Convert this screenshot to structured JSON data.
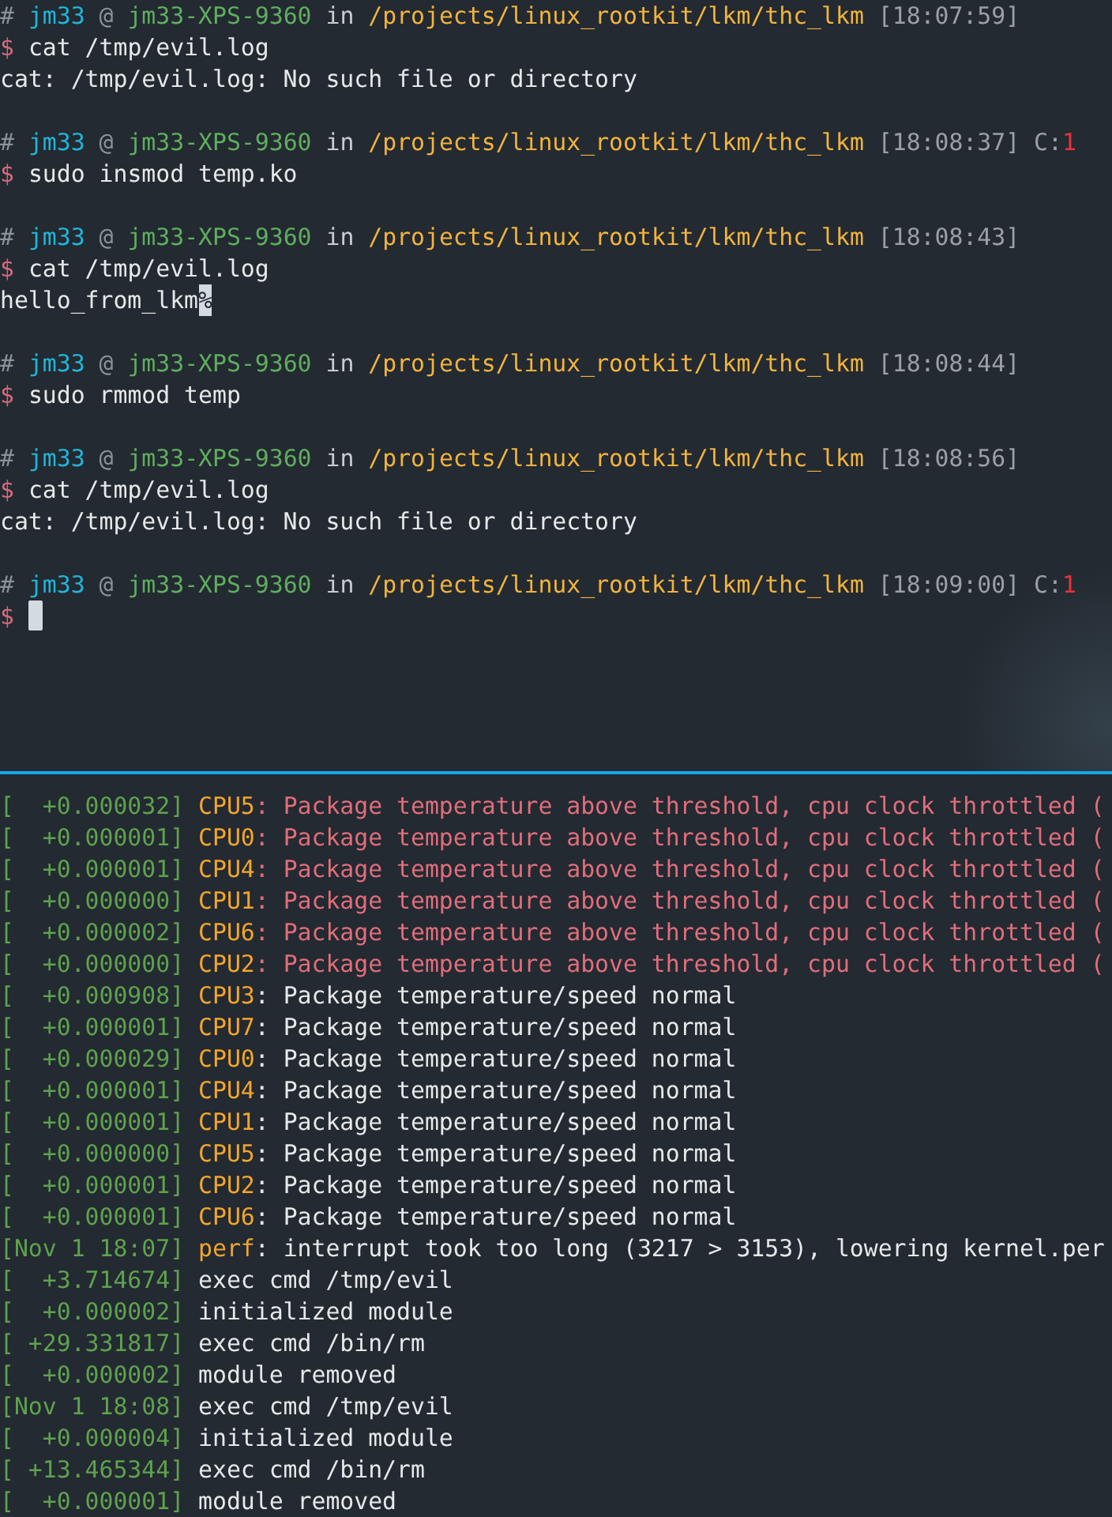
{
  "shell": {
    "prompts": [
      {
        "marker": "#",
        "user": "jm33",
        "at": "@",
        "host": "jm33-XPS-9360",
        "in": "in",
        "path": "/projects/linux_rootkit/lkm/thc_lkm",
        "time": "[18:07:59]",
        "symbol": "$",
        "command": "cat /tmp/evil.log",
        "output": [
          {
            "kind": "text",
            "text": "cat: /tmp/evil.log: No such file or directory"
          }
        ]
      },
      {
        "marker": "#",
        "user": "jm33",
        "at": "@",
        "host": "jm33-XPS-9360",
        "in": "in",
        "path": "/projects/linux_rootkit/lkm/thc_lkm",
        "time": "[18:08:37]",
        "exit_label": "C:",
        "exit_code": "1",
        "symbol": "$",
        "command": "sudo insmod temp.ko"
      },
      {
        "marker": "#",
        "user": "jm33",
        "at": "@",
        "host": "jm33-XPS-9360",
        "in": "in",
        "path": "/projects/linux_rootkit/lkm/thc_lkm",
        "time": "[18:08:43]",
        "symbol": "$",
        "command": "cat /tmp/evil.log",
        "output": [
          {
            "kind": "partial",
            "text": "hello_from_lkm",
            "mark": "%"
          }
        ]
      },
      {
        "marker": "#",
        "user": "jm33",
        "at": "@",
        "host": "jm33-XPS-9360",
        "in": "in",
        "path": "/projects/linux_rootkit/lkm/thc_lkm",
        "time": "[18:08:44]",
        "symbol": "$",
        "command": "sudo rmmod temp"
      },
      {
        "marker": "#",
        "user": "jm33",
        "at": "@",
        "host": "jm33-XPS-9360",
        "in": "in",
        "path": "/projects/linux_rootkit/lkm/thc_lkm",
        "time": "[18:08:56]",
        "symbol": "$",
        "command": "cat /tmp/evil.log",
        "output": [
          {
            "kind": "text",
            "text": "cat: /tmp/evil.log: No such file or directory"
          }
        ]
      },
      {
        "marker": "#",
        "user": "jm33",
        "at": "@",
        "host": "jm33-XPS-9360",
        "in": "in",
        "path": "/projects/linux_rootkit/lkm/thc_lkm",
        "time": "[18:09:00]",
        "exit_label": "C:",
        "exit_code": "1",
        "symbol": "$",
        "cursor": true
      }
    ]
  },
  "kernel_log": [
    {
      "timestamp": "[  +0.000032]",
      "source": "CPU5",
      "alert": true,
      "message": ": Package temperature above threshold, cpu clock throttled ("
    },
    {
      "timestamp": "[  +0.000001]",
      "source": "CPU0",
      "alert": true,
      "message": ": Package temperature above threshold, cpu clock throttled ("
    },
    {
      "timestamp": "[  +0.000001]",
      "source": "CPU4",
      "alert": true,
      "message": ": Package temperature above threshold, cpu clock throttled ("
    },
    {
      "timestamp": "[  +0.000000]",
      "source": "CPU1",
      "alert": true,
      "message": ": Package temperature above threshold, cpu clock throttled ("
    },
    {
      "timestamp": "[  +0.000002]",
      "source": "CPU6",
      "alert": true,
      "message": ": Package temperature above threshold, cpu clock throttled ("
    },
    {
      "timestamp": "[  +0.000000]",
      "source": "CPU2",
      "alert": true,
      "message": ": Package temperature above threshold, cpu clock throttled ("
    },
    {
      "timestamp": "[  +0.000908]",
      "source": "CPU3",
      "alert": false,
      "message": ": Package temperature/speed normal"
    },
    {
      "timestamp": "[  +0.000001]",
      "source": "CPU7",
      "alert": false,
      "message": ": Package temperature/speed normal"
    },
    {
      "timestamp": "[  +0.000029]",
      "source": "CPU0",
      "alert": false,
      "message": ": Package temperature/speed normal"
    },
    {
      "timestamp": "[  +0.000001]",
      "source": "CPU4",
      "alert": false,
      "message": ": Package temperature/speed normal"
    },
    {
      "timestamp": "[  +0.000001]",
      "source": "CPU1",
      "alert": false,
      "message": ": Package temperature/speed normal"
    },
    {
      "timestamp": "[  +0.000000]",
      "source": "CPU5",
      "alert": false,
      "message": ": Package temperature/speed normal"
    },
    {
      "timestamp": "[  +0.000001]",
      "source": "CPU2",
      "alert": false,
      "message": ": Package temperature/speed normal"
    },
    {
      "timestamp": "[  +0.000001]",
      "source": "CPU6",
      "alert": false,
      "message": ": Package temperature/speed normal"
    },
    {
      "timestamp": "[Nov 1 18:07]",
      "source": "perf",
      "alert": false,
      "message": ": interrupt took too long (3217 > 3153), lowering kernel.per"
    },
    {
      "timestamp": "[  +3.714674]",
      "alert": false,
      "message": "exec cmd /tmp/evil"
    },
    {
      "timestamp": "[  +0.000002]",
      "alert": false,
      "message": "initialized module"
    },
    {
      "timestamp": "[ +29.331817]",
      "alert": false,
      "message": "exec cmd /bin/rm"
    },
    {
      "timestamp": "[  +0.000002]",
      "alert": false,
      "message": "module removed"
    },
    {
      "timestamp": "[Nov 1 18:08]",
      "alert": false,
      "message": "exec cmd /tmp/evil"
    },
    {
      "timestamp": "[  +0.000004]",
      "alert": false,
      "message": "initialized module"
    },
    {
      "timestamp": "[ +13.465344]",
      "alert": false,
      "message": "exec cmd /bin/rm"
    },
    {
      "timestamp": "[  +0.000001]",
      "alert": false,
      "message": "module removed"
    }
  ]
}
